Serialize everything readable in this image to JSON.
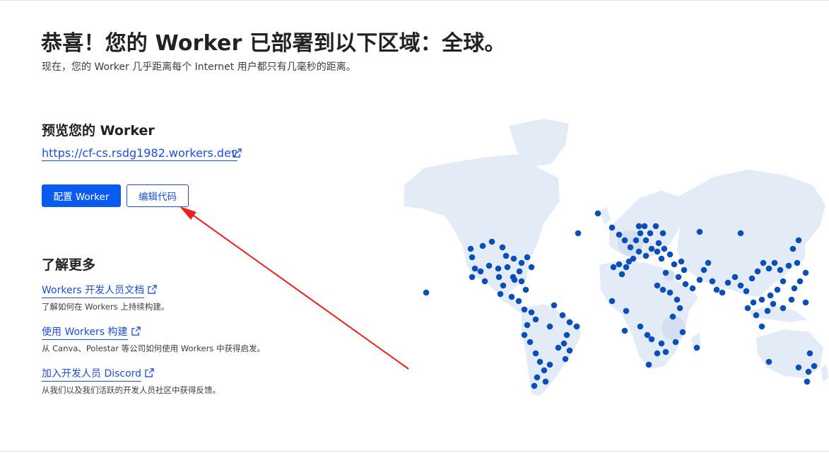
{
  "header": {
    "title": "恭喜！您的 Worker 已部署到以下区域：全球。",
    "subtitle": "现在，您的 Worker 几乎距离每个 Internet 用户都只有几毫秒的距离。"
  },
  "preview": {
    "heading": "预览您的 Worker",
    "url": "https://cf-cs.rsdg1982.workers.dev",
    "configure_label": "配置 Worker",
    "edit_label": "编辑代码"
  },
  "learn": {
    "heading": "了解更多",
    "items": [
      {
        "link": "Workers 开发人员文档",
        "desc": "了解如何在 Workers 上持续构建。"
      },
      {
        "link": "使用 Workers 构建",
        "desc": "从 Canva、Polestar 等公司如何使用 Workers 中获得启发。"
      },
      {
        "link": "加入开发人员 Discord",
        "desc": "从我们以及我们活跃的开发人员社区中获得反馈。"
      }
    ]
  },
  "icons": {
    "external_link": "external-link-icon",
    "annotation": "red-arrow-annotation"
  },
  "colors": {
    "link": "#1d4ed8",
    "primary_button": "#0a5cf0",
    "map_land": "#e3ebf6",
    "map_dot": "#0a4fb5",
    "annotation_arrow": "#e8231f"
  }
}
